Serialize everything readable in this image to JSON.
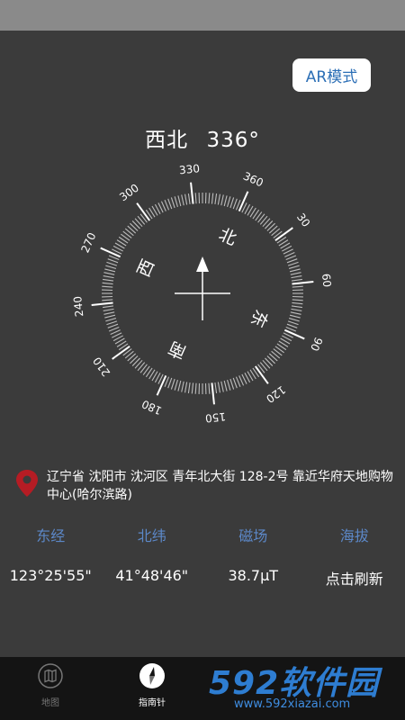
{
  "ar_button": {
    "label": "AR模式"
  },
  "heading": {
    "direction": "西北",
    "degrees": "336°"
  },
  "compass": {
    "heading_deg": 336,
    "cardinals": {
      "north": "北",
      "east": "东",
      "south": "南",
      "west": "西"
    },
    "degree_labels": [
      "360",
      "30",
      "60",
      "90",
      "120",
      "150",
      "180",
      "210",
      "240",
      "270",
      "300",
      "330"
    ]
  },
  "location": {
    "address": "辽宁省 沈阳市 沈河区 青年北大街 128-2号 靠近华府天地购物中心(哈尔滨路)",
    "pin_color": "#b51c24"
  },
  "info": {
    "labels": [
      "东经",
      "北纬",
      "磁场",
      "海拔"
    ],
    "values": [
      "123°25'55\"",
      "41°48'46\"",
      "38.7μT",
      "点击刷新"
    ]
  },
  "nav": {
    "map_label": "地图",
    "compass_label": "指南针",
    "map_icon": "map-icon",
    "compass_icon": "compass-icon"
  },
  "watermark": {
    "logo": "592软件园",
    "url": "www.592xiazai.com"
  },
  "colors": {
    "background": "#3b3b3b",
    "accent": "#5c88c8",
    "ar_text": "#2c6fb6",
    "nav_bg": "#141414"
  }
}
